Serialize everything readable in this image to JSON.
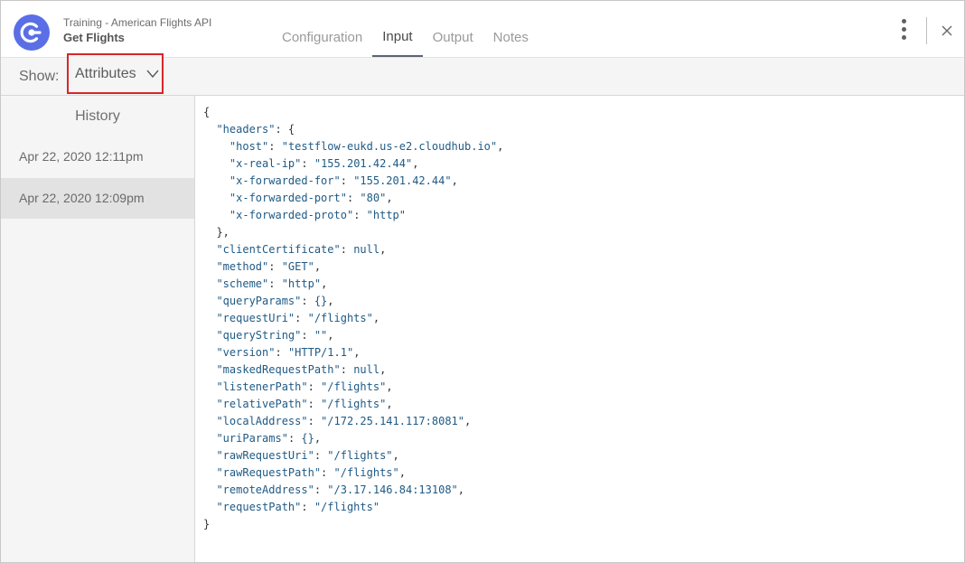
{
  "header": {
    "app_subtitle": "Training - American Flights API",
    "app_title": "Get Flights",
    "tabs": [
      {
        "label": "Configuration",
        "active": false
      },
      {
        "label": "Input",
        "active": true
      },
      {
        "label": "Output",
        "active": false
      },
      {
        "label": "Notes",
        "active": false
      }
    ],
    "icons": {
      "logo": "mulesoft-connector-icon",
      "menu": "kebab-menu-icon",
      "close": "close-icon"
    }
  },
  "toolbar": {
    "show_label": "Show:",
    "dropdown_value": "Attributes"
  },
  "history": {
    "title": "History",
    "items": [
      {
        "label": "Apr 22, 2020 12:11pm",
        "selected": false
      },
      {
        "label": "Apr 22, 2020 12:09pm",
        "selected": true
      }
    ]
  },
  "code": {
    "headers": [
      [
        "host",
        "testflow-eukd.us-e2.cloudhub.io"
      ],
      [
        "x-real-ip",
        "155.201.42.44"
      ],
      [
        "x-forwarded-for",
        "155.201.42.44"
      ],
      [
        "x-forwarded-port",
        "80"
      ],
      [
        "x-forwarded-proto",
        "http"
      ]
    ],
    "fields": [
      [
        "clientCertificate",
        "null",
        "raw"
      ],
      [
        "method",
        "GET",
        "str"
      ],
      [
        "scheme",
        "http",
        "str"
      ],
      [
        "queryParams",
        "{}",
        "raw"
      ],
      [
        "requestUri",
        "/flights",
        "str"
      ],
      [
        "queryString",
        "",
        "str"
      ],
      [
        "version",
        "HTTP/1.1",
        "str"
      ],
      [
        "maskedRequestPath",
        "null",
        "raw"
      ],
      [
        "listenerPath",
        "/flights",
        "str"
      ],
      [
        "relativePath",
        "/flights",
        "str"
      ],
      [
        "localAddress",
        "/172.25.141.117:8081",
        "str"
      ],
      [
        "uriParams",
        "{}",
        "raw"
      ],
      [
        "rawRequestUri",
        "/flights",
        "str"
      ],
      [
        "rawRequestPath",
        "/flights",
        "str"
      ],
      [
        "remoteAddress",
        "/3.17.146.84:13108",
        "str"
      ],
      [
        "requestPath",
        "/flights",
        "str"
      ]
    ]
  },
  "colors": {
    "accent": "#5a6fe6",
    "highlight_border": "#d7262b",
    "json_value": "#1f5a85"
  }
}
